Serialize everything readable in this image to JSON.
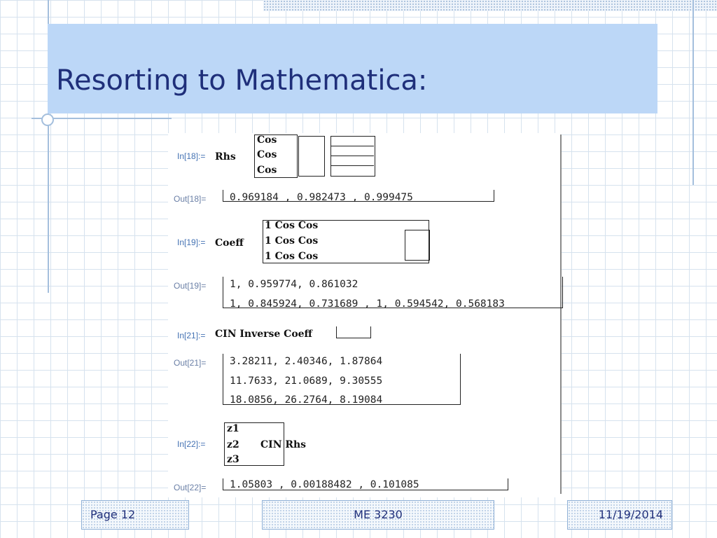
{
  "slide": {
    "title": "Resorting to Mathematica:",
    "footer": {
      "page": "Page 12",
      "course": "ME 3230",
      "date": "11/19/2014"
    }
  },
  "notebook": {
    "in18": {
      "label": "In[18]:=",
      "lhs": "Rhs",
      "rows": [
        "Cos",
        "Cos",
        "Cos"
      ]
    },
    "out18": {
      "label": "Out[18]=",
      "text": "0.969184 ,  0.982473 ,  0.999475"
    },
    "in19": {
      "label": "In[19]:=",
      "lhs": "Coeff",
      "rows": [
        "1  Cos        Cos",
        "1  Cos        Cos",
        "1  Cos        Cos"
      ]
    },
    "out19": {
      "label": "Out[19]=",
      "line1": "1, 0.959774, 0.861032",
      "line2": "1, 0.845924, 0.731689 ,  1, 0.594542, 0.568183"
    },
    "in21": {
      "label": "In[21]:=",
      "text": "CIN Inverse Coeff"
    },
    "out21": {
      "label": "Out[21]=",
      "rows": [
        "3.28211, 2.40346, 1.87864",
        "11.7633, 21.0689, 9.30555",
        "18.0856, 26.2764, 8.19084"
      ]
    },
    "in22": {
      "label": "In[22]:=",
      "zs": [
        "z1",
        "z2",
        "z3"
      ],
      "rhs": "CIN Rhs"
    },
    "out22": {
      "label": "Out[22]=",
      "text": "1.05803 ,   0.00188482 ,  0.101085"
    }
  }
}
